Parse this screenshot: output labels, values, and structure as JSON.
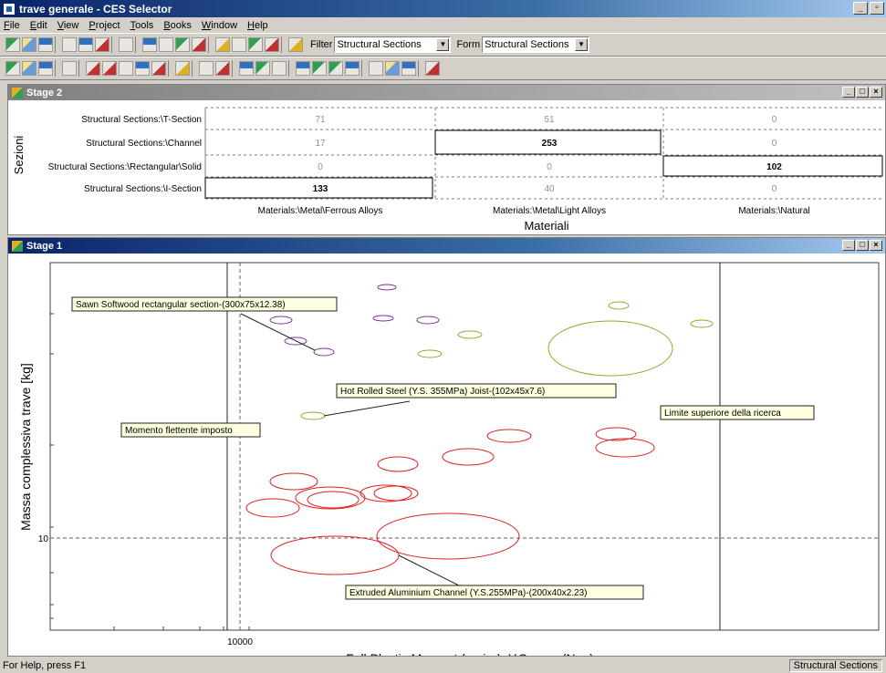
{
  "window": {
    "title": "trave generale - CES Selector"
  },
  "menu": [
    "File",
    "Edit",
    "View",
    "Project",
    "Tools",
    "Books",
    "Window",
    "Help"
  ],
  "toolbar": {
    "filter_label": "Filter",
    "filter_value": "Structural Sections",
    "form_label": "Form",
    "form_value": "Structural Sections"
  },
  "stage2": {
    "title": "Stage 2",
    "row_axis_label": "Sezioni",
    "col_axis_label": "Materiali",
    "rows": [
      "Structural Sections:\\T-Section",
      "Structural Sections:\\Channel",
      "Structural Sections:\\Rectangular\\Solid",
      "Structural Sections:\\I-Section"
    ],
    "columns": [
      "Materials:\\Metal\\Ferrous Alloys",
      "Materials:\\Metal\\Light Alloys",
      "Materials:\\Natural"
    ],
    "cells": [
      [
        "71",
        "51",
        "0"
      ],
      [
        "17",
        "253",
        "0"
      ],
      [
        "0",
        "0",
        "102"
      ],
      [
        "133",
        "40",
        "0"
      ]
    ],
    "highlighted": [
      [
        1,
        1
      ],
      [
        2,
        2
      ],
      [
        3,
        0
      ]
    ]
  },
  "stage1": {
    "title": "Stage 1",
    "xlabel": "Full Plastic Moment (major), Y.S_max (N.m)",
    "ylabel": "Massa complessiva trave [kg]",
    "x_tick": "10000",
    "y_tick": "10",
    "annotations": [
      "Sawn Softwood rectangular section-(300x75x12.38)",
      "Hot Rolled Steel (Y.S. 355MPa) Joist-(102x45x7.6)",
      "Momento flettente imposto",
      "Limite superiore della ricerca",
      "Extruded Aluminium Channel (Y.S.255MPa)-(200x40x2.23)"
    ],
    "colors": {
      "red": "#e02020",
      "purple": "#8030a0",
      "olive": "#a0a030"
    }
  },
  "status": {
    "help": "For Help, press F1",
    "right": "Structural Sections"
  }
}
